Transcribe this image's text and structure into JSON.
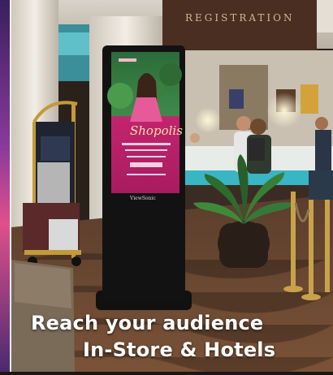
{
  "headline": {
    "line1": "Reach your audience",
    "line2": "In-Store & Hotels"
  },
  "kiosk": {
    "brand_label": "ViewSonic"
  },
  "poster": {
    "brand": "Shopolis"
  },
  "wall_sign": {
    "text": "REGISTRATION"
  },
  "colors": {
    "headline": "#ffffff",
    "kiosk_body": "#121212",
    "poster_pink": "#c2246e",
    "carpet": "#6b4a35",
    "counter_teal": "#39b5c4"
  }
}
